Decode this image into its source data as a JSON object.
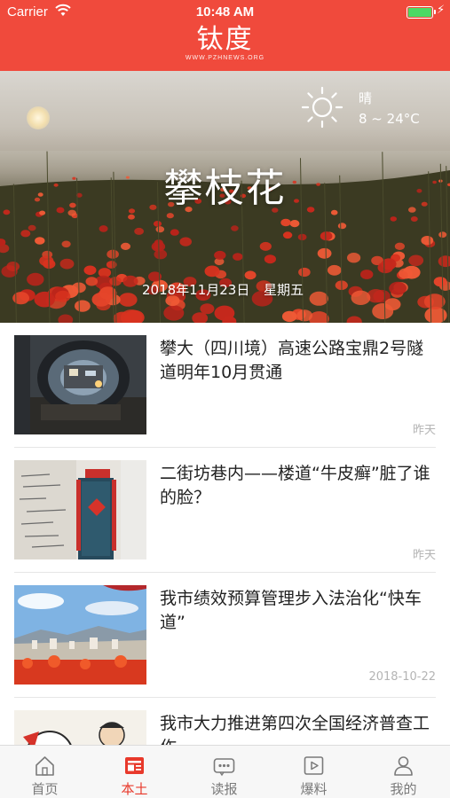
{
  "status_bar": {
    "carrier": "Carrier",
    "time": "10:48 AM"
  },
  "header": {
    "logo_text": "钛度",
    "logo_sub": "WWW.PZHNEWS.ORG"
  },
  "hero": {
    "city": "攀枝花",
    "date": "2018年11月23日",
    "weekday": "星期五",
    "weather": {
      "condition": "晴",
      "temperature": "8 ~ 24°C",
      "icon": "sun-icon"
    }
  },
  "news": [
    {
      "title": "攀大（四川境）高速公路宝鼎2号隧道明年10月贯通",
      "time": "昨天",
      "thumb": "tunnel-photo"
    },
    {
      "title": "二街坊巷内——楼道“牛皮癣”脏了谁的脸？",
      "time": "昨天",
      "thumb": "wall-ads-photo"
    },
    {
      "title": "我市绩效预算管理步入法治化“快车道”",
      "time": "2018-10-22",
      "thumb": "city-view-photo"
    },
    {
      "title": "我市大力推进第四次全国经济普查工作",
      "time": "",
      "thumb": "cartoon-illustration"
    }
  ],
  "tabs": [
    {
      "label": "首页",
      "icon": "home-icon",
      "active": false
    },
    {
      "label": "本土",
      "icon": "local-news-icon",
      "active": true
    },
    {
      "label": "读报",
      "icon": "newspaper-icon",
      "active": false
    },
    {
      "label": "爆料",
      "icon": "video-icon",
      "active": false
    },
    {
      "label": "我的",
      "icon": "profile-icon",
      "active": false
    }
  ],
  "colors": {
    "brand_red": "#f04a3c",
    "active_tab": "#e8392b",
    "meta_gray": "#b4b4b4",
    "battery_green": "#4cd964"
  }
}
